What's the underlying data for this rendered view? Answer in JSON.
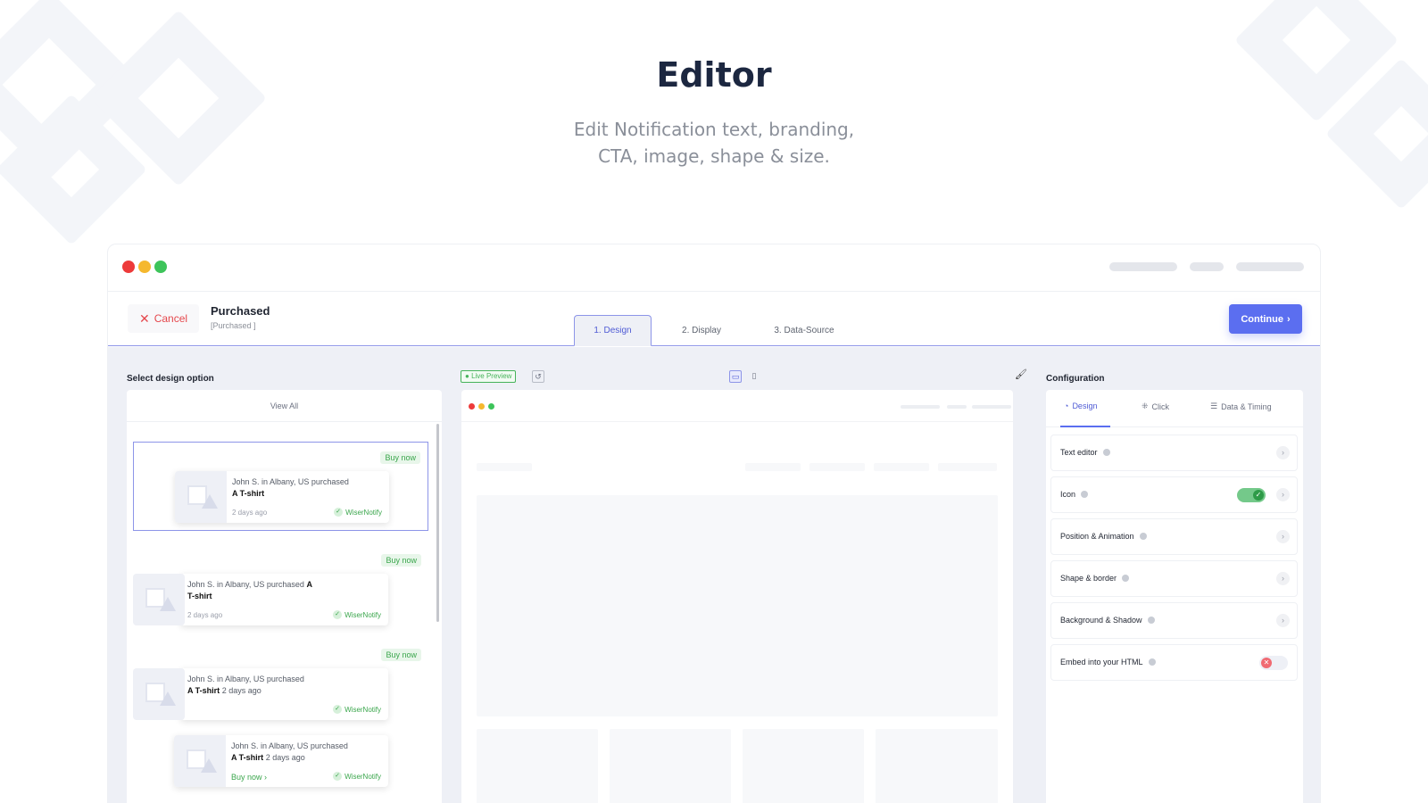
{
  "hero": {
    "title": "Editor",
    "subtitle_line1": "Edit Notification text, branding,",
    "subtitle_line2": "CTA, image, shape & size."
  },
  "window": {
    "traffic_colors": [
      "#ed3a3a",
      "#f5b82e",
      "#3dc45a"
    ]
  },
  "header": {
    "cancel_label": "Cancel",
    "notification_name": "Purchased",
    "notification_tag": "[Purchased ]",
    "tabs": [
      {
        "label": "1. Design",
        "active": true
      },
      {
        "label": "2. Display",
        "active": false
      },
      {
        "label": "3. Data-Source",
        "active": false
      }
    ],
    "continue_label": "Continue"
  },
  "left": {
    "title": "Select design option",
    "view_all": "View All",
    "options": [
      {
        "badge": "Buy now",
        "text_prefix": "John S. in Albany, US purchased",
        "product": "A T-shirt",
        "time": "2 days ago",
        "brand": "WiserNotify",
        "selected": true
      },
      {
        "badge": "Buy now",
        "text_prefix": "John S. in Albany, US purchased",
        "product_part1": "A",
        "product_part2": "T-shirt",
        "time": "2 days ago",
        "brand": "WiserNotify",
        "selected": false
      },
      {
        "badge": "Buy now",
        "text_prefix": "John S. in Albany, US purchased",
        "product": "A T-shirt",
        "time": "2 days ago",
        "brand": "WiserNotify",
        "selected": false
      },
      {
        "text_prefix": "John S. in Albany, US purchased",
        "product": "A T-shirt",
        "time": "2 days ago",
        "cta": "Buy now",
        "brand": "WiserNotify",
        "selected": false
      }
    ]
  },
  "preview": {
    "live_label": "Live Preview"
  },
  "config": {
    "title": "Configuration",
    "tabs": [
      {
        "label": "Design",
        "icon": "palette-icon",
        "active": true
      },
      {
        "label": "Click",
        "icon": "click-icon",
        "active": false
      },
      {
        "label": "Data & Timing",
        "icon": "sliders-icon",
        "active": false
      }
    ],
    "rows": [
      {
        "label": "Text editor",
        "control": "chevron"
      },
      {
        "label": "Icon",
        "control": "toggle-on"
      },
      {
        "label": "Position & Animation",
        "control": "chevron"
      },
      {
        "label": "Shape & border",
        "control": "chevron"
      },
      {
        "label": "Background & Shadow",
        "control": "chevron"
      },
      {
        "label": "Embed into your HTML",
        "control": "toggle-off"
      }
    ]
  }
}
